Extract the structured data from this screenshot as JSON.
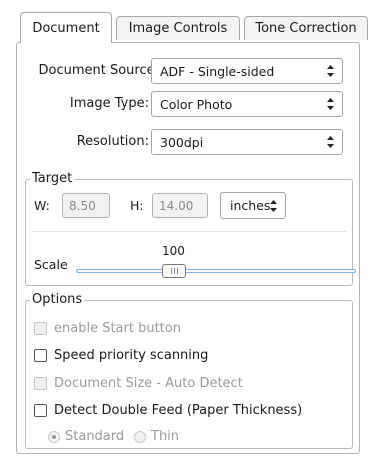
{
  "tabs": [
    {
      "label": "Document",
      "active": true
    },
    {
      "label": "Image Controls",
      "active": false
    },
    {
      "label": "Tone Correction",
      "active": false
    }
  ],
  "document_source": {
    "label": "Document Source:",
    "value": "ADF - Single-sided"
  },
  "image_type": {
    "label": "Image Type:",
    "value": "Color Photo"
  },
  "resolution": {
    "label": "Resolution:",
    "value": "300dpi"
  },
  "target": {
    "title": "Target",
    "width_label": "W:",
    "width_value": "8.50",
    "height_label": "H:",
    "height_value": "14.00",
    "units": "inches",
    "scale_label": "Scale",
    "scale_value": "100"
  },
  "options": {
    "title": "Options",
    "items": [
      {
        "label": "enable Start button",
        "checked": false,
        "enabled": false
      },
      {
        "label": "Speed priority scanning",
        "checked": false,
        "enabled": true
      },
      {
        "label": "Document Size - Auto Detect",
        "checked": false,
        "enabled": false
      },
      {
        "label": "Detect Double Feed (Paper Thickness)",
        "checked": false,
        "enabled": true
      }
    ],
    "thickness": [
      {
        "label": "Standard",
        "selected": true,
        "enabled": false
      },
      {
        "label": "Thin",
        "selected": false,
        "enabled": false
      }
    ]
  }
}
